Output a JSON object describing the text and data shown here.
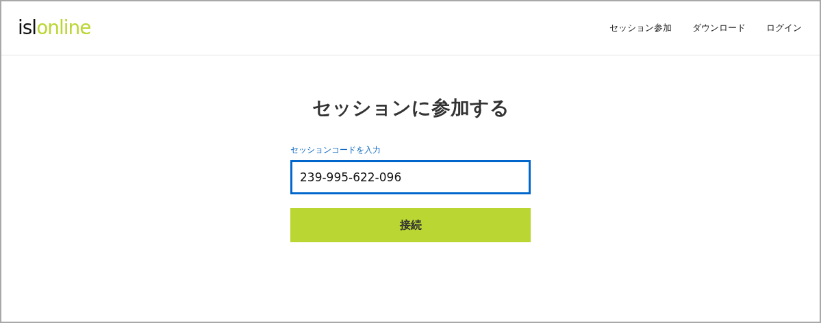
{
  "header": {
    "logo": {
      "dark_part": "isl",
      "green_part": "online"
    },
    "nav": [
      {
        "label": "セッション参加"
      },
      {
        "label": "ダウンロード"
      },
      {
        "label": "ログイン"
      }
    ]
  },
  "main": {
    "title": "セッションに参加する",
    "field": {
      "label": "セッションコードを入力",
      "value": "239-995-622-096",
      "focused": true
    },
    "button": "接続"
  }
}
